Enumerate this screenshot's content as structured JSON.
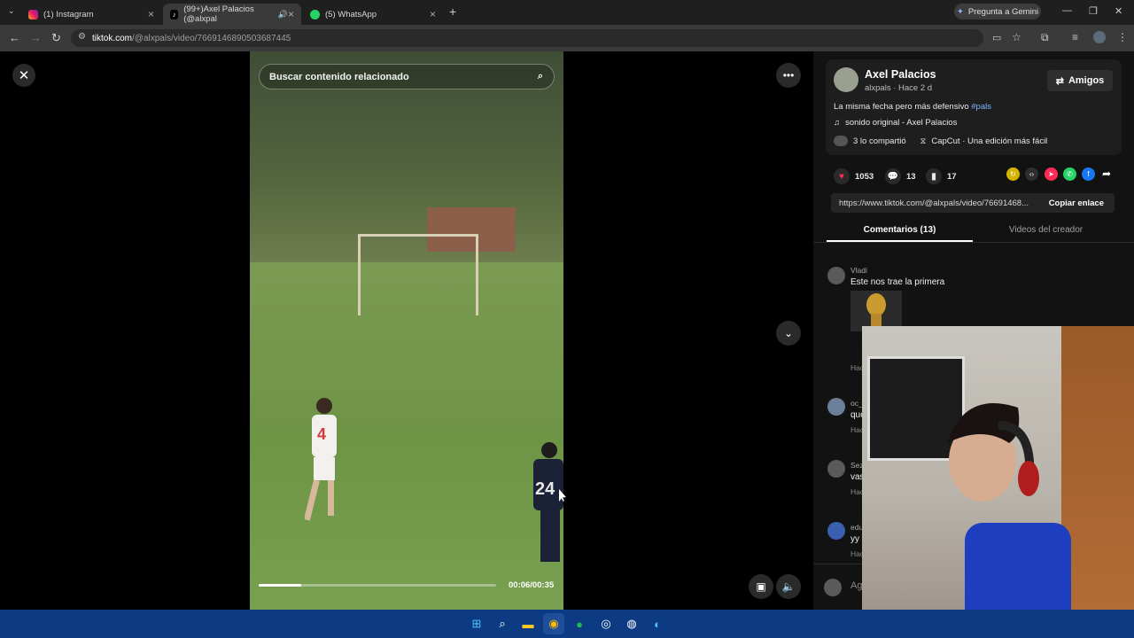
{
  "browser": {
    "tabs": [
      {
        "label": "(1) Instagram",
        "favicon": "instagram-icon",
        "active": false
      },
      {
        "label": "(99+)Axel Palacios (@alxpal",
        "favicon": "tiktok-icon",
        "active": true
      },
      {
        "label": "(5) WhatsApp",
        "favicon": "whatsapp-icon",
        "active": false
      }
    ],
    "gemini_label": "Pregunta a Gemini",
    "url_host": "tiktok.com",
    "url_path": "/@alxpals/video/7669146890503687445"
  },
  "video": {
    "search_placeholder": "Buscar contenido relacionado",
    "time": "00:06/00:35",
    "progress": 0.18,
    "player1_number": "4",
    "player2_number": "24"
  },
  "post": {
    "author": "Axel Palacios",
    "handle_time": "alxpals · Hace 2 d",
    "follow_label": "Amigos",
    "description": "La misma fecha pero más defensivo ",
    "hashtag": "#pals",
    "sound": "sonido original - Axel Palacios",
    "shared_by": "3 lo compartió",
    "capcut": "CapCut · Una edición más fácil",
    "likes": "1053",
    "comments": "13",
    "saves": "17",
    "link": "https://www.tiktok.com/@alxpals/video/76691468...",
    "copy_label": "Copiar enlace"
  },
  "panel_tabs": {
    "comments": "Comentarios (13)",
    "creator_videos": "Videos del creador"
  },
  "comments": [
    {
      "user": "Vladi",
      "text": "Este nos trae la primera",
      "meta": "Hac"
    },
    {
      "user": "oc_",
      "text": "que",
      "meta": "Hac"
    },
    {
      "user": "Sez",
      "text": "vas",
      "meta": "Hac"
    },
    {
      "user": "edu",
      "text": "yy",
      "meta": "Hac"
    }
  ],
  "add_comment_placeholder": "Ag",
  "colors": {
    "like": "#fe2c55",
    "link": "#7fb4ff",
    "taskbar": "#0c3b83"
  }
}
